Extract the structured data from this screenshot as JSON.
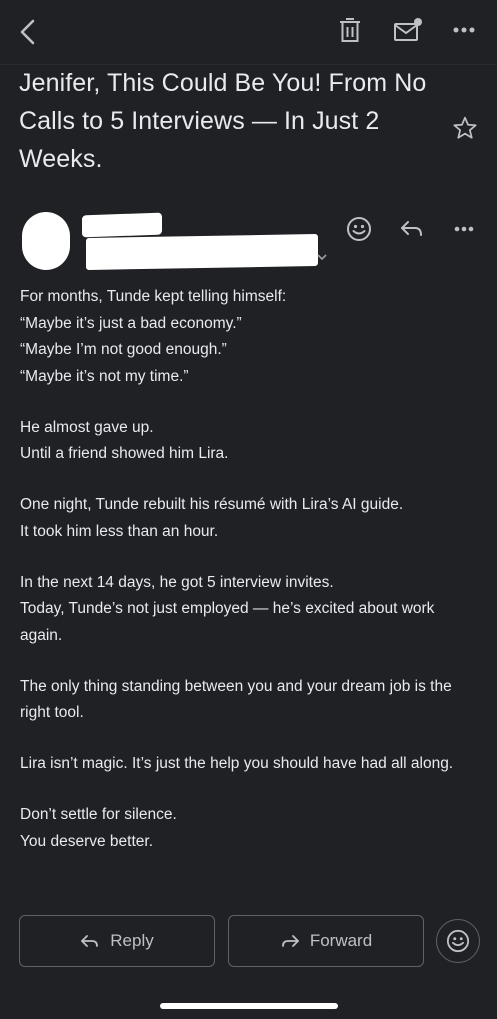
{
  "toolbar": {
    "back_icon": "chevron-left-icon",
    "delete_icon": "trash-icon",
    "mark_unread_icon": "mail-unread-icon",
    "more_icon": "more-horizontal-icon"
  },
  "email": {
    "subject": "Jenifer, This Could Be You! From No Calls to 5 Interviews — In Just 2 Weeks.",
    "star_icon": "star-outline-icon",
    "sender": {
      "avatar_icon": "avatar",
      "emoji_icon": "emoji-smile-icon",
      "reply_icon": "reply-icon",
      "more_icon": "more-horizontal-icon"
    },
    "paragraphs": [
      [
        "For months, Tunde kept telling himself:",
        "“Maybe it’s just a bad economy.”",
        "“Maybe I’m not good enough.”",
        "“Maybe it’s not my time.”"
      ],
      [
        "He almost gave up.",
        "Until a friend showed him Lira."
      ],
      [
        "One night, Tunde rebuilt his résumé with Lira’s AI guide.",
        "It took him less than an hour."
      ],
      [
        "In the next 14 days, he got 5 interview invites.",
        "Today, Tunde’s not just employed — he’s excited about work again."
      ],
      [
        "The only thing standing between you and your dream job is the right tool."
      ],
      [
        "Lira isn’t magic. It’s just the help you should have had all along."
      ],
      [
        "Don’t settle for silence.",
        "You deserve better."
      ]
    ]
  },
  "actions": {
    "reply_label": "Reply",
    "forward_label": "Forward",
    "reply_icon": "reply-icon",
    "forward_icon": "forward-icon",
    "emoji_icon": "emoji-smile-icon"
  }
}
